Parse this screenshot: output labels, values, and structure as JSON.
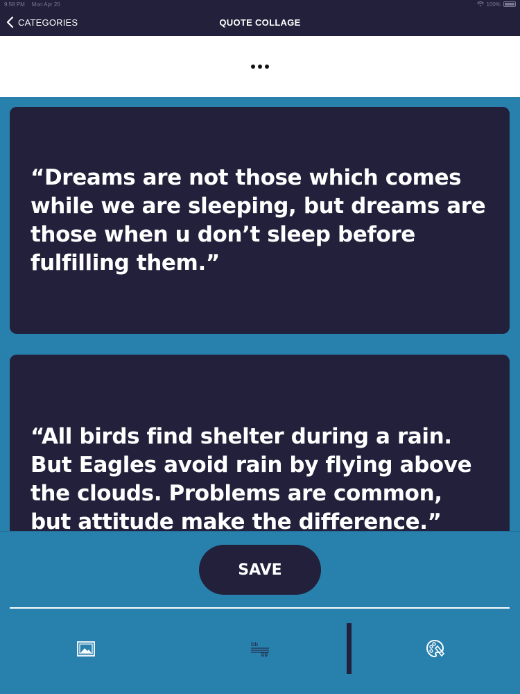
{
  "status_bar": {
    "time": "9:58 PM",
    "date": "Mon Apr 20",
    "battery": "100%"
  },
  "nav": {
    "back_label": "CATEGORIES",
    "title": "QUOTE COLLAGE"
  },
  "options": {
    "more_icon": "ellipsis-icon"
  },
  "quotes": [
    {
      "text": "“Dreams are not those which comes while we are sleeping, but dreams are those when u don’t sleep before fulfilling them.”"
    },
    {
      "text": "“All birds find shelter during a rain. But Eagles avoid rain by flying above the clouds. Problems are common, but attitude make the difference.”"
    }
  ],
  "bottom": {
    "save_label": "SAVE",
    "tools": [
      {
        "icon": "image-icon"
      },
      {
        "icon": "text-format-icon"
      },
      {
        "icon": "palette-icon"
      }
    ]
  },
  "colors": {
    "background": "#2880ad",
    "dark": "#22203a",
    "white": "#ffffff"
  }
}
